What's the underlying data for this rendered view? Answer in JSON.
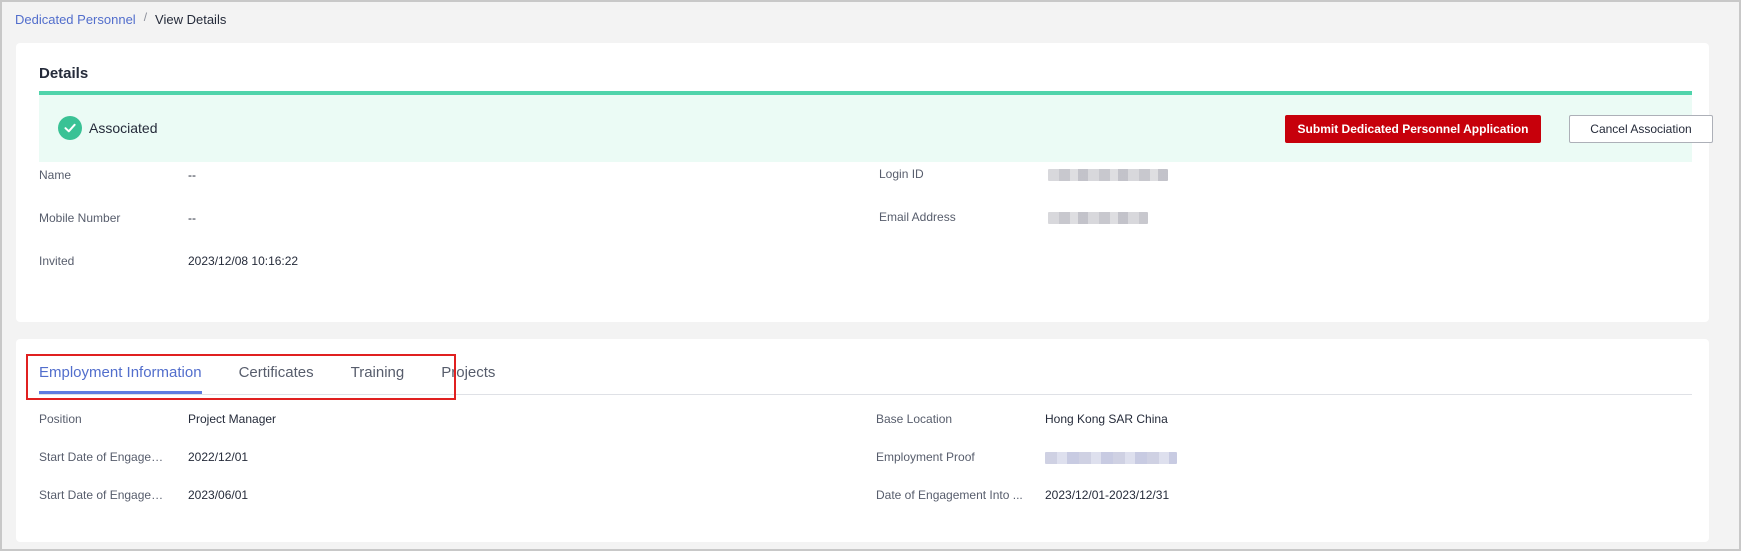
{
  "breadcrumb": {
    "parent": "Dedicated Personnel",
    "separator": "/",
    "current": "View Details"
  },
  "details": {
    "title": "Details",
    "status": {
      "icon": "check-circle-icon",
      "text": "Associated",
      "color": "#3ac295"
    },
    "actions": {
      "submit_label": "Submit Dedicated Personnel Application",
      "cancel_label": "Cancel Association"
    },
    "fields": {
      "name_label": "Name",
      "name_value": "--",
      "mobile_label": "Mobile Number",
      "mobile_value": "--",
      "invited_label": "Invited",
      "invited_value": "2023/12/08 10:16:22",
      "login_label": "Login ID",
      "email_label": "Email Address"
    }
  },
  "tabs": {
    "items": [
      {
        "label": "Employment Information",
        "active": true
      },
      {
        "label": "Certificates"
      },
      {
        "label": "Training"
      },
      {
        "label": "Projects"
      }
    ]
  },
  "employment": {
    "position_label": "Position",
    "position_value": "Project Manager",
    "start1_label": "Start Date of Engagemen...",
    "start1_value": "2022/12/01",
    "start2_label": "Start Date of Engagemen...",
    "start2_value": "2023/06/01",
    "base_label": "Base Location",
    "base_value": "Hong Kong SAR China",
    "proof_label": "Employment Proof",
    "date_into_label": "Date of Engagement Into ...",
    "date_into_value": "2023/12/01-2023/12/31"
  },
  "colors": {
    "accent": "#526ecc",
    "primary_button": "#c7000b",
    "banner_bg": "#ebfbf5",
    "banner_border": "#50d4ab",
    "highlight": "#e02020"
  }
}
